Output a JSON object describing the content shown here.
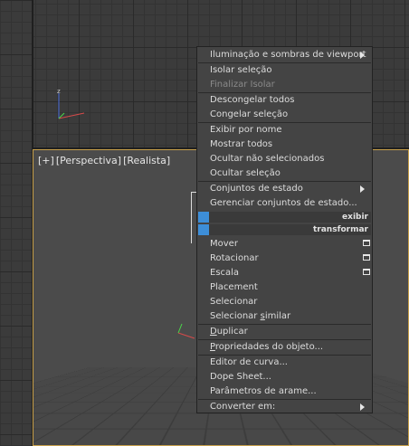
{
  "viewport": {
    "labels": [
      "[+]",
      "[Perspectiva]",
      "[Realista]"
    ]
  },
  "menu": {
    "items": [
      {
        "label": "Iluminação e sombras de viewport",
        "submenu": true
      },
      {
        "label": "Isolar seleção"
      },
      {
        "label": "Finalizar Isolar",
        "disabled": true
      },
      {
        "label": "Descongelar todos"
      },
      {
        "label": "Congelar seleção"
      },
      {
        "label": "Exibir por nome"
      },
      {
        "label": "Mostrar todos"
      },
      {
        "label": "Ocultar não selecionados"
      },
      {
        "label": "Ocultar seleção"
      },
      {
        "label": "Conjuntos de estado",
        "submenu": true
      },
      {
        "label": "Gerenciar conjuntos de estado..."
      },
      {
        "label": "Mover",
        "options": true
      },
      {
        "label": "Rotacionar",
        "options": true
      },
      {
        "label": "Escala",
        "options": true
      },
      {
        "label": "Placement"
      },
      {
        "label": "Selecionar"
      },
      {
        "label": "Selecionar similar",
        "underline_prefix": "Selecionar ",
        "underline_char": "s",
        "underline_suffix": "imilar"
      },
      {
        "label": "Duplicar",
        "underline_char": "D",
        "underline_suffix": "uplicar"
      },
      {
        "label": "Propriedades do objeto...",
        "underline_char": "P",
        "underline_suffix": "ropriedades do objeto..."
      },
      {
        "label": "Editor de curva..."
      },
      {
        "label": "Dope Sheet..."
      },
      {
        "label": "Parâmetros de arame..."
      },
      {
        "label": "Converter em:",
        "submenu": true
      }
    ],
    "quad_labels": {
      "display": "exibir",
      "transform": "transformar"
    }
  },
  "colors": {
    "active_viewport_border": "#c9a14b",
    "quad_swatch": "#3d8ed8"
  }
}
